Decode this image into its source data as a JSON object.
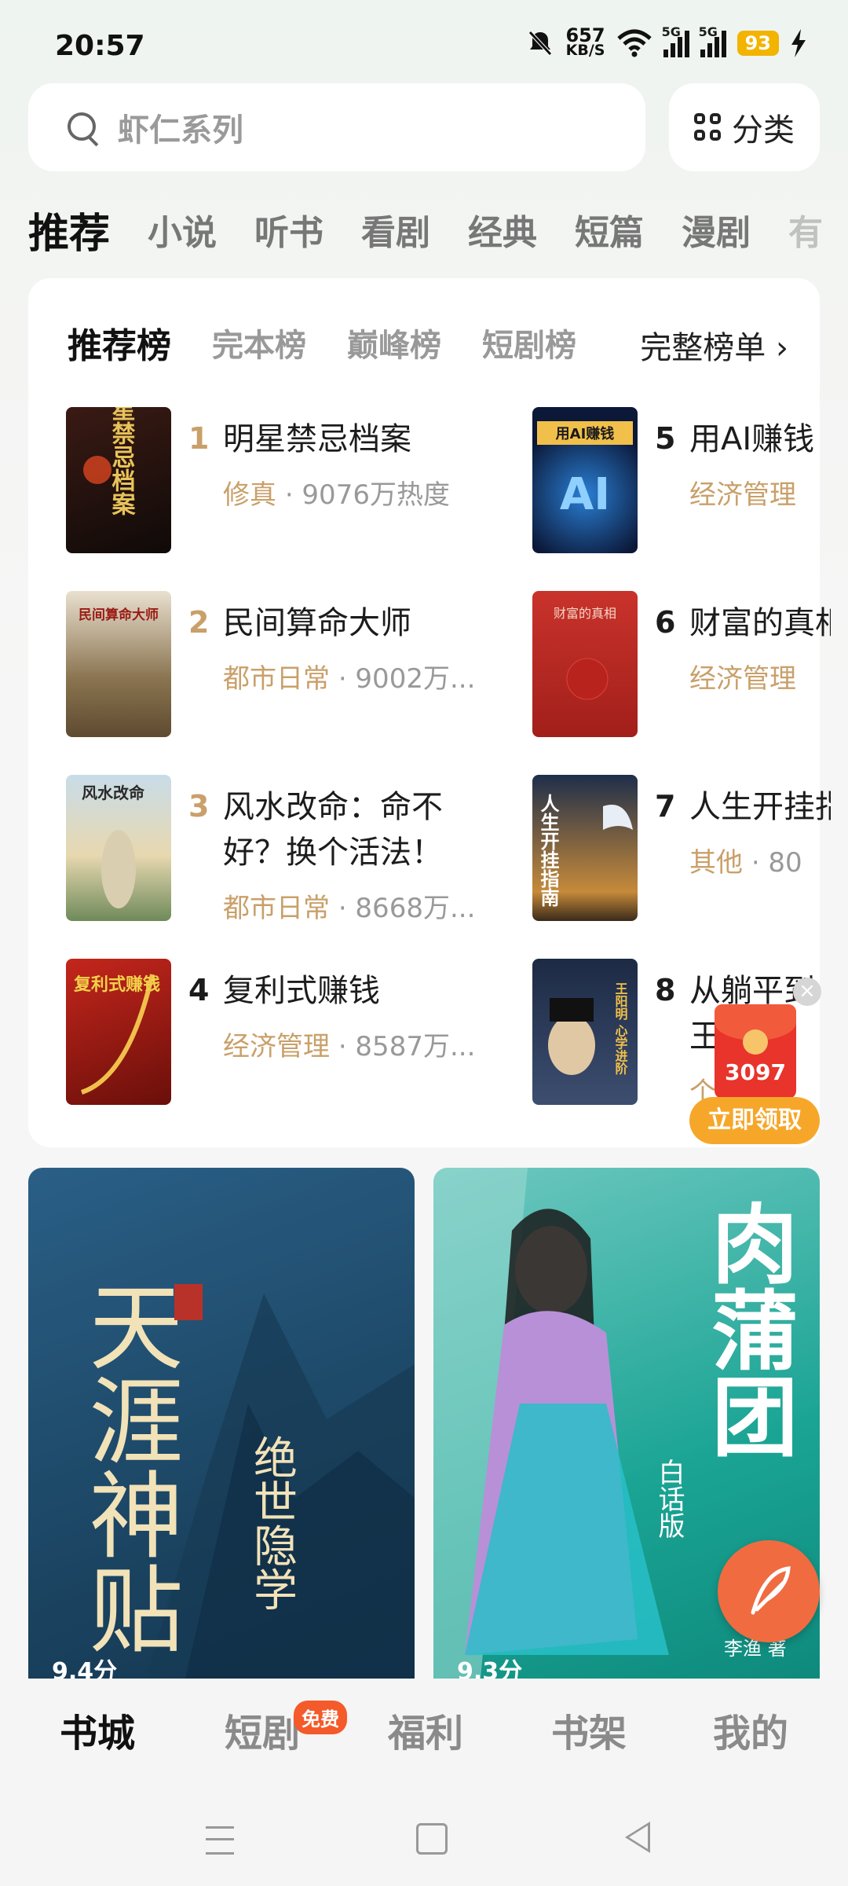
{
  "status": {
    "time": "20:57",
    "speed_value": "657",
    "speed_unit": "KB/S",
    "net1": "5G",
    "net2": "5G",
    "battery": "93"
  },
  "search": {
    "placeholder": "虾仁系列",
    "category_label": "分类"
  },
  "tabs": [
    "推荐",
    "小说",
    "听书",
    "看剧",
    "经典",
    "短篇",
    "漫剧",
    "有"
  ],
  "ranking": {
    "tabs": [
      "推荐榜",
      "完本榜",
      "巅峰榜",
      "短剧榜"
    ],
    "full_label": "完整榜单 ›",
    "items": [
      {
        "rank": "1",
        "title": "明星禁忌档案",
        "category": "修真",
        "heat": "· 9076万热度"
      },
      {
        "rank": "2",
        "title": "民间算命大师",
        "category": "都市日常",
        "heat": "· 9002万..."
      },
      {
        "rank": "3",
        "title": "风水改命：命不",
        "title2": "好？换个活法！",
        "category": "都市日常",
        "heat": "· 8668万..."
      },
      {
        "rank": "4",
        "title": "复利式赚钱",
        "category": "经济管理",
        "heat": "· 8587万..."
      },
      {
        "rank": "5",
        "title": "用AI赚钱",
        "category": "经济管理",
        "heat": ""
      },
      {
        "rank": "6",
        "title": "财富的真相",
        "category": "经济管理",
        "heat": ""
      },
      {
        "rank": "7",
        "title": "人生开挂指南",
        "category": "其他",
        "heat": "· 80"
      },
      {
        "rank": "8",
        "title": "从躺平到",
        "title2": "王",
        "category": "个",
        "heat": ""
      }
    ],
    "cover_texts": [
      "明星禁忌档案",
      "民间算命大师",
      "风水改命",
      "复利式赚钱",
      "用AI赚钱",
      "财富的真相",
      "人生开挂指南",
      "王阳明 心学进阶"
    ]
  },
  "red_packet": {
    "amount": "3097",
    "button": "立即领取",
    "close": "×"
  },
  "featured": [
    {
      "title": "天涯神贴",
      "subtitle": "绝世隐学",
      "score": "9.4分"
    },
    {
      "title": "肉蒲团",
      "subtitle": "白话版",
      "author": "李渔 著",
      "score": "9.3分"
    }
  ],
  "bottom_nav": {
    "items": [
      "书城",
      "短剧",
      "福利",
      "书架",
      "我的"
    ],
    "badge": "免费"
  }
}
